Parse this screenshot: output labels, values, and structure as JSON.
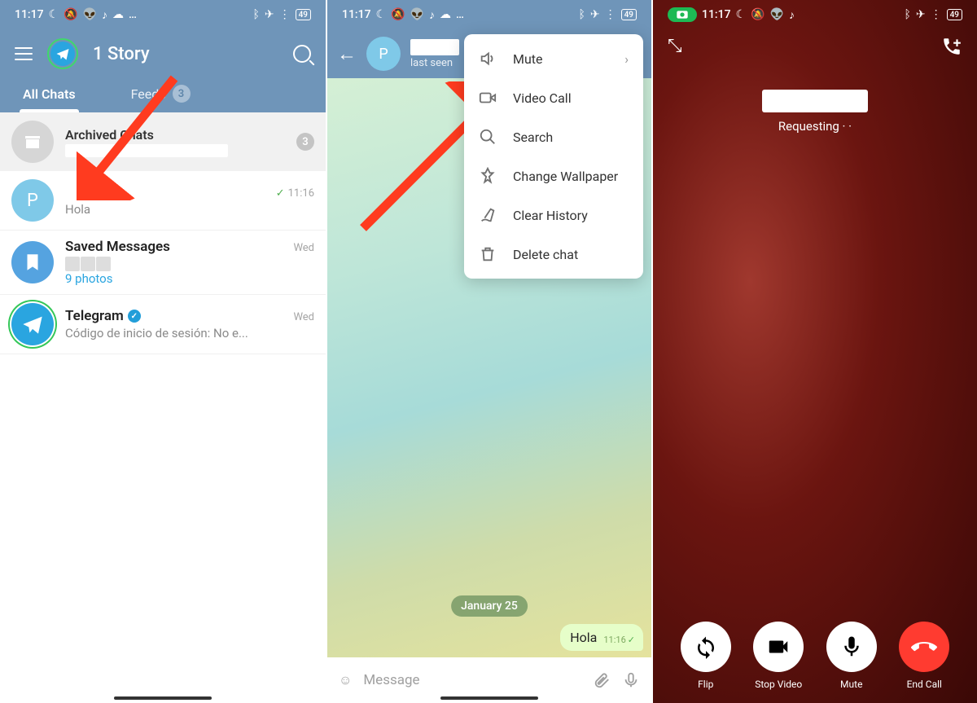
{
  "statusbar": {
    "time": "11:17",
    "battery": "49"
  },
  "screen1": {
    "title": "1 Story",
    "tabs": {
      "all": "All Chats",
      "feeds": "Feeds",
      "feeds_badge": "3"
    },
    "archived": {
      "title": "Archived Chats",
      "badge": "3"
    },
    "chats": [
      {
        "avatar": "P",
        "msg": "Hola",
        "time": "11:16"
      },
      {
        "name": "Saved Messages",
        "photos": "9 photos",
        "time": "Wed"
      },
      {
        "name": "Telegram",
        "msg": "Código de inicio de sesión:            No e...",
        "time": "Wed"
      }
    ]
  },
  "screen2": {
    "last_seen": "last seen",
    "menu": {
      "mute": "Mute",
      "video": "Video Call",
      "search": "Search",
      "wallpaper": "Change Wallpaper",
      "clear": "Clear History",
      "delete": "Delete chat"
    },
    "date": "January 25",
    "message": {
      "text": "Hola",
      "time": "11:16"
    },
    "input_placeholder": "Message"
  },
  "screen3": {
    "status": "Requesting · ·",
    "controls": {
      "flip": "Flip",
      "stop": "Stop Video",
      "mute": "Mute",
      "end": "End Call"
    }
  }
}
